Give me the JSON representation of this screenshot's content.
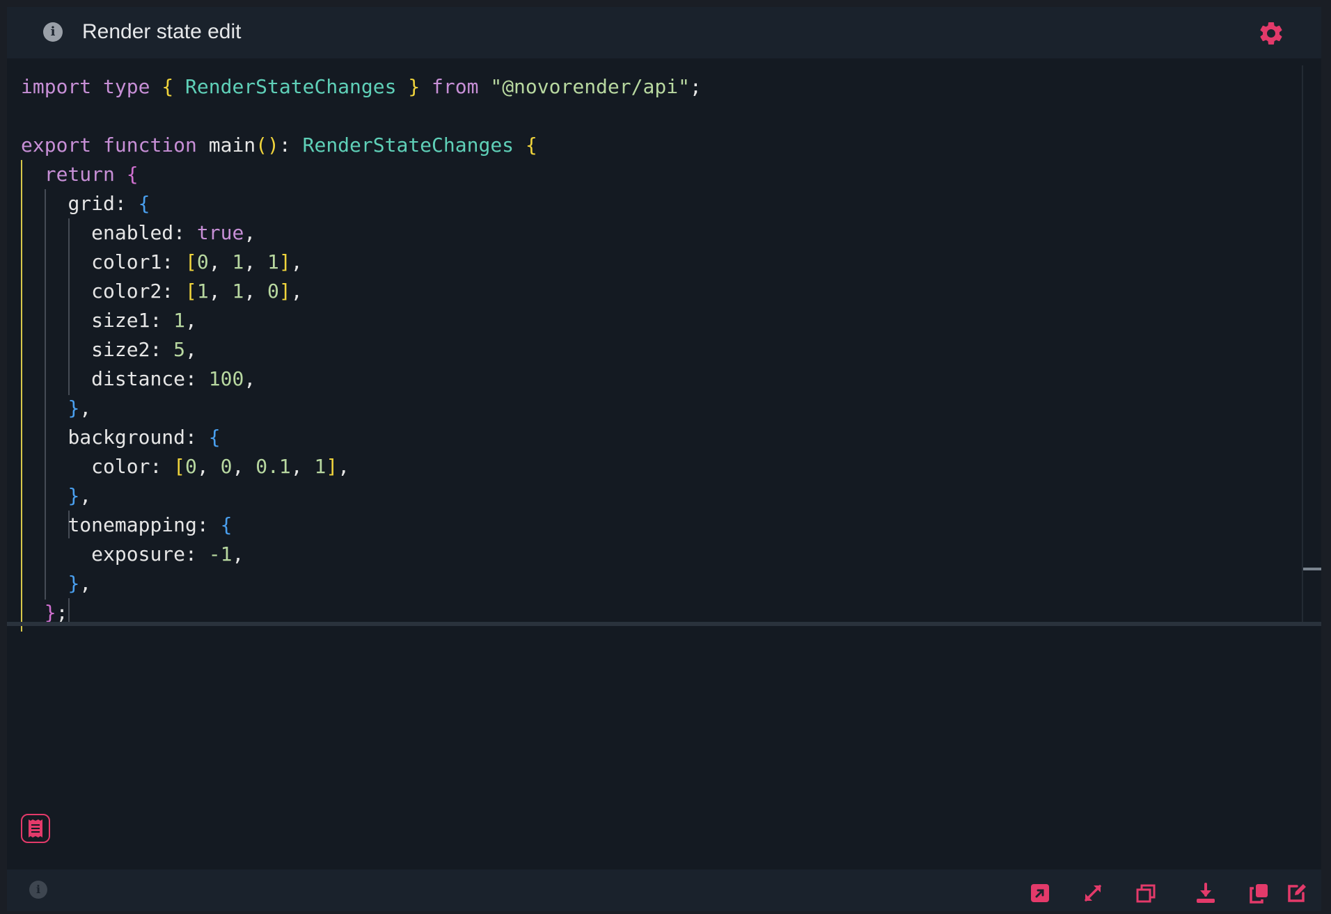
{
  "window": {
    "title": "Render state edit"
  },
  "header": {
    "info_icon": "info-icon",
    "settings_icon": "gear-icon"
  },
  "code": {
    "language": "typescript",
    "l1": {
      "import": "import",
      "type": "type",
      "lb": "{",
      "name": "RenderStateChanges",
      "rb": "}",
      "from": "from",
      "module": "\"@novorender/api\"",
      "semi": ";"
    },
    "l3": {
      "export": "export",
      "function": "function",
      "main": "main",
      "parens": "()",
      "colon": ":",
      "rtype": "RenderStateChanges",
      "lb": "{"
    },
    "l4": {
      "ret": "return",
      "lb": "{"
    },
    "l5": {
      "key": "grid:",
      "lb": "{"
    },
    "l6": {
      "key": "enabled:",
      "val": "true",
      "comma": ","
    },
    "l7": {
      "key": "color1:",
      "lb": "[",
      "v1": "0",
      "v2": "1",
      "v3": "1",
      "rb": "]",
      "comma": ","
    },
    "l8": {
      "key": "color2:",
      "lb": "[",
      "v1": "1",
      "v2": "1",
      "v3": "0",
      "rb": "]",
      "comma": ","
    },
    "l9": {
      "key": "size1:",
      "val": "1",
      "comma": ","
    },
    "l10": {
      "key": "size2:",
      "val": "5",
      "comma": ","
    },
    "l11": {
      "key": "distance:",
      "val": "100",
      "comma": ","
    },
    "l12": {
      "rb": "}",
      "comma": ","
    },
    "l13": {
      "key": "background:",
      "lb": "{"
    },
    "l14": {
      "key": "color:",
      "lb": "[",
      "v1": "0",
      "v2": "0",
      "v3": "0.1",
      "v4": "1",
      "rb": "]",
      "comma": ","
    },
    "l15": {
      "rb": "}",
      "comma": ","
    },
    "l16": {
      "key": "tonemapping:",
      "lb": "{"
    },
    "l17": {
      "key": "exposure:",
      "val": "-1",
      "comma": ","
    },
    "l18": {
      "rb": "}",
      "comma": ","
    },
    "l19": {
      "rb": "}",
      "semi": ";"
    }
  },
  "notes_button": {
    "icon": "receipt-icon"
  },
  "footer": {
    "info_icon": "info-icon",
    "actions": [
      "open-external-icon",
      "expand-icon",
      "window-icon",
      "download-icon",
      "copy-icon",
      "edit-icon"
    ]
  },
  "colors": {
    "accent": "#e33a6a",
    "background": "#141a22",
    "bar": "#1a222c"
  }
}
